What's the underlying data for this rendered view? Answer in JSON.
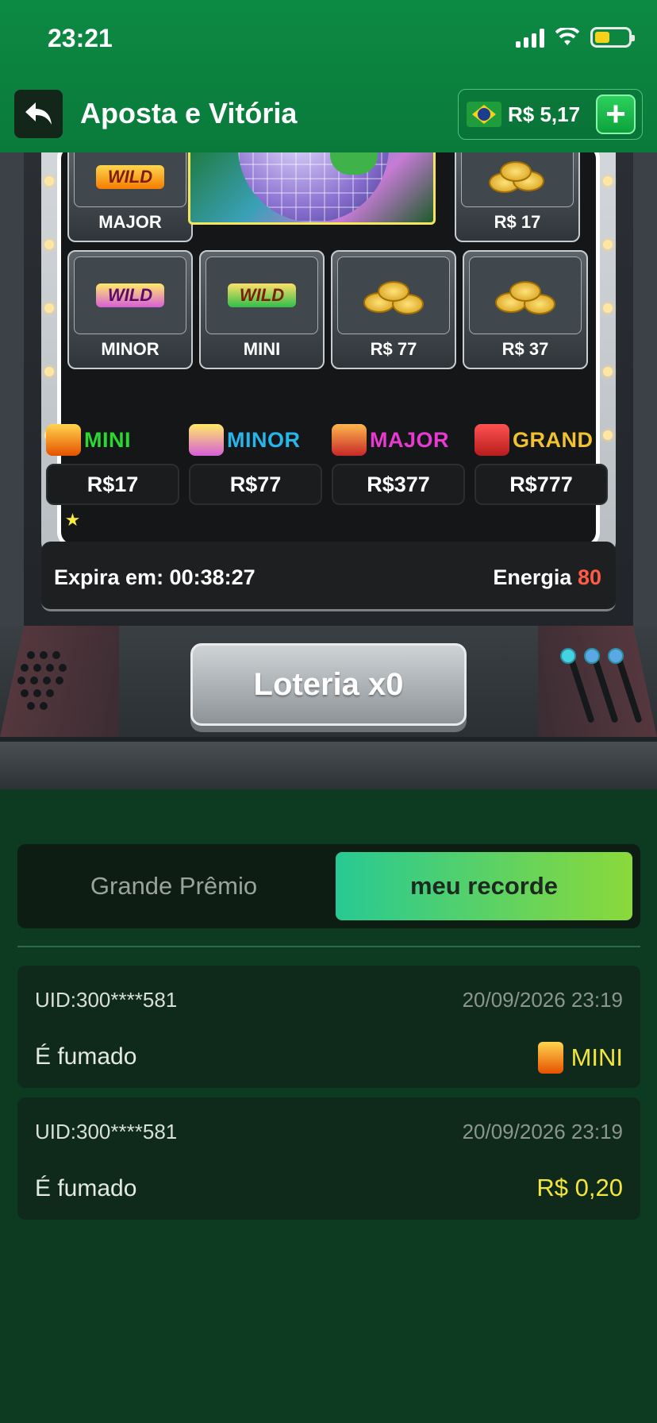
{
  "status": {
    "time": "23:21"
  },
  "header": {
    "title": "Aposta e Vitória",
    "balance": "R$ 5,17",
    "plus": "+"
  },
  "grid": {
    "row1": [
      {
        "label": "MAJOR",
        "icon": "wild-tiger"
      },
      {
        "label": "R$ 17",
        "icon": "gold-coins"
      }
    ],
    "row2": [
      {
        "label": "MINOR",
        "icon": "wild-rabbit"
      },
      {
        "label": "MINI",
        "icon": "wild-dragon"
      },
      {
        "label": "R$ 77",
        "icon": "gold-coins"
      },
      {
        "label": "R$ 37",
        "icon": "gold-coins"
      }
    ],
    "wild_text": "WILD"
  },
  "jackpots": [
    {
      "name": "MINI",
      "value": "R$17",
      "stars_on": 1,
      "color": "#29d92f"
    },
    {
      "name": "MINOR",
      "value": "R$77",
      "stars_on": 0,
      "color": "#27b6ea"
    },
    {
      "name": "MAJOR",
      "value": "R$377",
      "stars_on": 0,
      "color": "#e83ad0"
    },
    {
      "name": "GRAND",
      "value": "R$777",
      "stars_on": 0,
      "color": "#f2c12e"
    }
  ],
  "info": {
    "expires_label": "Expira em: 00:38:27",
    "energy_label": "Energia",
    "energy_value": "80"
  },
  "spin_button": "Loteria x0",
  "tabs": {
    "grand": "Grande Prêmio",
    "record": "meu recorde"
  },
  "records": [
    {
      "uid": "UID:300****581",
      "date": "20/09/2026 23:19",
      "message": "É fumado",
      "prize": "MINI",
      "prize_icon": true
    },
    {
      "uid": "UID:300****581",
      "date": "20/09/2026 23:19",
      "message": "É fumado",
      "prize": "R$ 0,20",
      "prize_icon": false
    }
  ],
  "colors": {
    "header": "#0c8a43",
    "background": "#0d3b22",
    "accent_yellow": "#f3e53b",
    "energy": "#ff5b45"
  }
}
